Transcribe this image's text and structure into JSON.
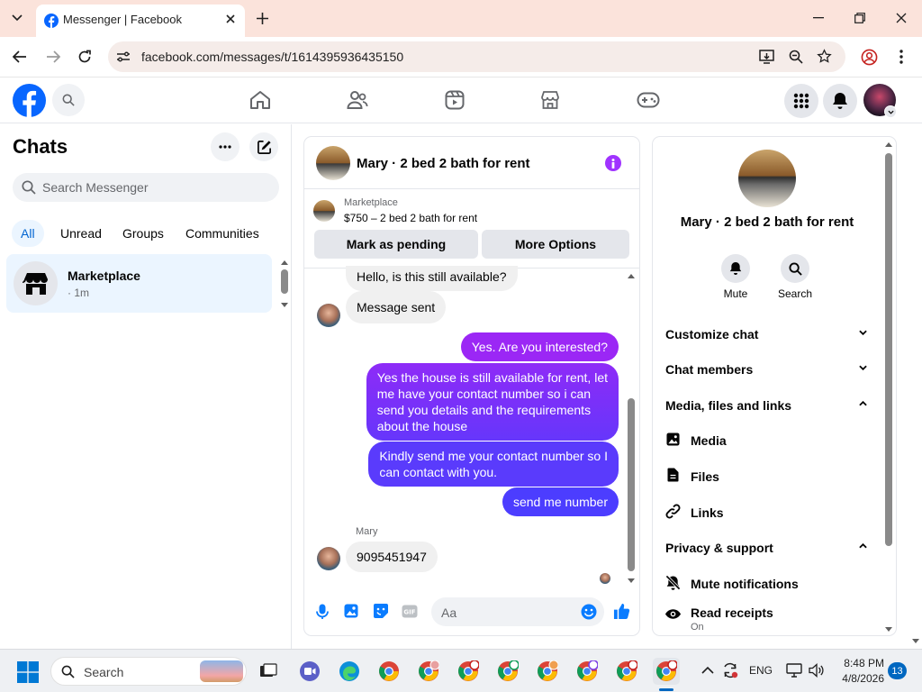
{
  "browser": {
    "tab_title": "Messenger | Facebook",
    "url": "facebook.com/messages/t/1614395936435150"
  },
  "chats_panel": {
    "title": "Chats",
    "search_placeholder": "Search Messenger",
    "filters": [
      "All",
      "Unread",
      "Groups",
      "Communities"
    ],
    "active_filter": "All",
    "conversations": [
      {
        "name": "Marketplace",
        "time": "· 1m"
      }
    ]
  },
  "chat": {
    "name": "Mary · 2 bed 2 bath for rent",
    "marketplace_label": "Marketplace",
    "listing": "$750 – 2 bed 2 bath for rent",
    "mark_pending_label": "Mark as pending",
    "more_options_label": "More Options",
    "messages": [
      {
        "dir": "in",
        "text": "Hello, is this still available?"
      },
      {
        "dir": "in",
        "text": "Message sent"
      },
      {
        "dir": "out",
        "text": "Yes. Are you interested?"
      },
      {
        "dir": "out",
        "lines": [
          "Yes the house is still available for rent, let",
          "me have your contact number so i can",
          "send you details and the requirements",
          "about the house"
        ]
      },
      {
        "dir": "out",
        "lines": [
          "Kindly send me your contact number so I",
          "can contact with you."
        ]
      },
      {
        "dir": "out",
        "text": "send me number"
      },
      {
        "dir": "in",
        "sender": "Mary",
        "text": "9095451947"
      }
    ],
    "composer_placeholder": "Aa"
  },
  "info_panel": {
    "name": "Mary · 2 bed 2 bath for rent",
    "mute_label": "Mute",
    "search_label": "Search",
    "sections": {
      "customize": "Customize chat",
      "members": "Chat members",
      "media_files": "Media, files and links",
      "media": "Media",
      "files": "Files",
      "links": "Links",
      "privacy": "Privacy & support",
      "mute_notifications": "Mute notifications",
      "read_receipts": "Read receipts",
      "read_receipts_status": "On"
    }
  },
  "taskbar": {
    "search_label": "Search",
    "language": "ENG",
    "time": "8:48 PM",
    "date": "4/8/2026",
    "notification_count": "13"
  },
  "colors": {
    "fb_blue": "#0866ff",
    "accent_purple": "#a033ff",
    "bubble_start": "#9b27f5",
    "bubble_end": "#4c3dff",
    "composer_icon": "#0a7cff"
  }
}
